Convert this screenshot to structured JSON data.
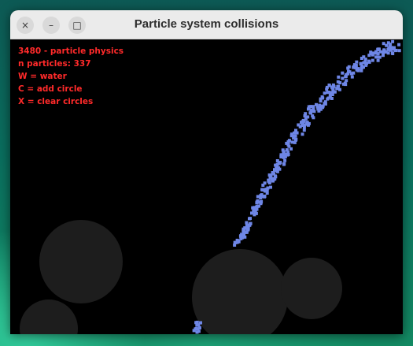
{
  "window": {
    "title": "Particle system collisions",
    "close_icon": "×",
    "minimize_icon": "–",
    "maximize_icon": "□"
  },
  "hud": {
    "fps_line": "3480 - particle physics",
    "count_line": "n particles: 337",
    "water_hint": "W = water",
    "add_hint": "C = add circle",
    "clear_hint": "X = clear circles"
  },
  "colors": {
    "particle": "#6e86e6",
    "circle": "#1d1d1d",
    "hud_text": "#ff2a2a",
    "canvas_background": "#000000"
  },
  "scene": {
    "particle_count": 337,
    "circle_count": 4
  }
}
